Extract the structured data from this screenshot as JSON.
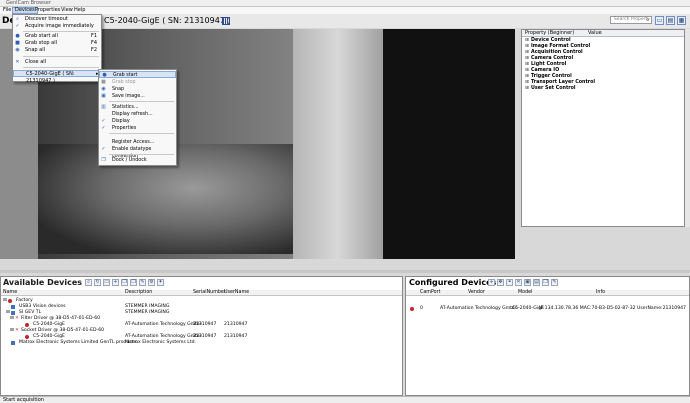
{
  "window": {
    "title": "GenICam Browser"
  },
  "menubar": {
    "items": [
      "File",
      "Devices",
      "Properties",
      "View",
      "Help"
    ]
  },
  "device_header": {
    "label": "De",
    "camera": "C5-2040-GigE ( SN: 21310947 )"
  },
  "search": {
    "placeholder": "Search Property",
    "icon": "search-icon"
  },
  "property_panel": {
    "col_property": "Property (Beginner)",
    "col_value": "Value",
    "groups": [
      "Device Control",
      "Image Format Control",
      "Acquisition Control",
      "Camera Control",
      "Light Control",
      "Camera IO",
      "Trigger Control",
      "Transport Layer Control",
      "User Set Control"
    ]
  },
  "devices_menu": {
    "items": [
      {
        "label": "Discover timeout",
        "shortcut": "",
        "icon": "search-icon"
      },
      {
        "label": "Acquire image immediately",
        "shortcut": "",
        "icon": "check-icon"
      },
      {
        "label": "Grab start all",
        "shortcut": "F1",
        "icon": "play-icon"
      },
      {
        "label": "Grab stop all",
        "shortcut": "F4",
        "icon": "stop-icon"
      },
      {
        "label": "Snap all",
        "shortcut": "F2",
        "icon": "camera-icon"
      },
      {
        "label": "Close all",
        "shortcut": "",
        "icon": "close-icon"
      },
      {
        "label": "C5-2040-GigE ( SN: 21310947 )",
        "shortcut": "",
        "icon": "arrow-right-icon"
      }
    ]
  },
  "device_submenu": {
    "items": [
      {
        "label": "Grab start",
        "icon": "play-icon"
      },
      {
        "label": "Grab stop",
        "icon": "stop-icon"
      },
      {
        "label": "Snap",
        "icon": "camera-icon"
      },
      {
        "label": "Save image...",
        "icon": "save-icon"
      },
      {
        "label": "Statistics...",
        "icon": "chart-icon"
      },
      {
        "label": "Display refresh...",
        "icon": "refresh-icon"
      },
      {
        "label": "Display",
        "icon": "check-icon"
      },
      {
        "label": "Properties",
        "icon": "check-icon"
      },
      {
        "label": "Register Access...",
        "icon": "register-icon"
      },
      {
        "label": "Enable datatype conversion",
        "icon": "check-icon"
      },
      {
        "label": "Dock / Undock",
        "icon": "dock-icon"
      }
    ]
  },
  "available": {
    "title": "Available Devices",
    "columns": [
      "Name",
      "Description",
      "SerialNumber",
      "UserName"
    ],
    "rows": [
      {
        "name": "Factory",
        "description": "",
        "serial": "",
        "user": ""
      },
      {
        "name": "USB3 Vision devices",
        "description": "STEMMER IMAGING",
        "serial": "",
        "user": ""
      },
      {
        "name": "SI GEV TL",
        "description": "STEMMER IMAGING",
        "serial": "",
        "user": ""
      },
      {
        "name": "Filter Driver @ 38-D5-47-01-ED-60",
        "description": "",
        "serial": "",
        "user": ""
      },
      {
        "name": "C5-2040-GigE",
        "description": "AT-Automation Technology GmbH",
        "serial": "21310947",
        "user": "21310947"
      },
      {
        "name": "Socket Driver @ 38-D5-47-01-ED-60",
        "description": "",
        "serial": "",
        "user": ""
      },
      {
        "name": "C5-2040-GigE",
        "description": "AT-Automation Technology GmbH",
        "serial": "21310947",
        "user": "21310947"
      },
      {
        "name": "Matrox Electronic Systems Limited GenTL producer",
        "description": "Matrox Electronic Systems Ltd.",
        "serial": "",
        "user": ""
      }
    ]
  },
  "configured": {
    "title": "Configured Devices",
    "columns": [
      "CamPort",
      "Vendor",
      "Model",
      "Info"
    ],
    "rows": [
      {
        "camport": "0",
        "vendor": "AT-Automation Technology GmbH",
        "model": "C5-2040-GigE",
        "info": "IP:134.130.78.36  MAC:70-B3-D5-02-87-32  UserName:21310947"
      }
    ]
  },
  "status": {
    "text": "Start acquisition"
  }
}
